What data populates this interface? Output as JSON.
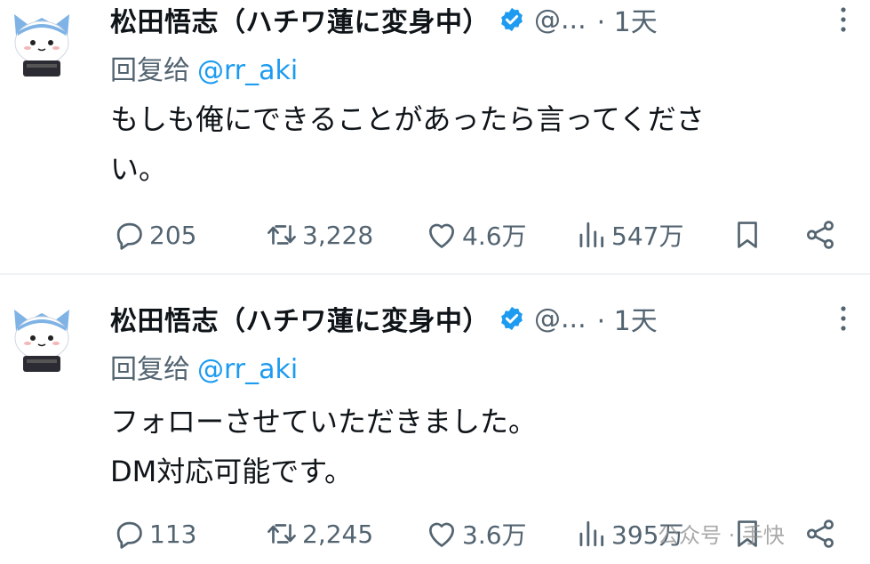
{
  "tweets": [
    {
      "author": "松田悟志（ハチワ蓮に変身中）",
      "handle": "@...",
      "time": "· 1天",
      "reply_prefix": "回复给",
      "reply_mention": "@rr_aki",
      "text_lines": [
        "もしも俺にできることがあったら言ってくださ",
        "い。"
      ],
      "stats": {
        "replies": "205",
        "retweets": "3,228",
        "likes": "4.6万",
        "views": "547万"
      }
    },
    {
      "author": "松田悟志（ハチワ蓮に変身中）",
      "handle": "@...",
      "time": "· 1天",
      "reply_prefix": "回复给",
      "reply_mention": "@rr_aki",
      "text_lines": [
        "フォローさせていただきました。",
        "DM対応可能です。"
      ],
      "stats": {
        "replies": "113",
        "retweets": "2,245",
        "likes": "3.6万",
        "views": "395万"
      }
    }
  ],
  "watermark": "公众号 · 手快"
}
